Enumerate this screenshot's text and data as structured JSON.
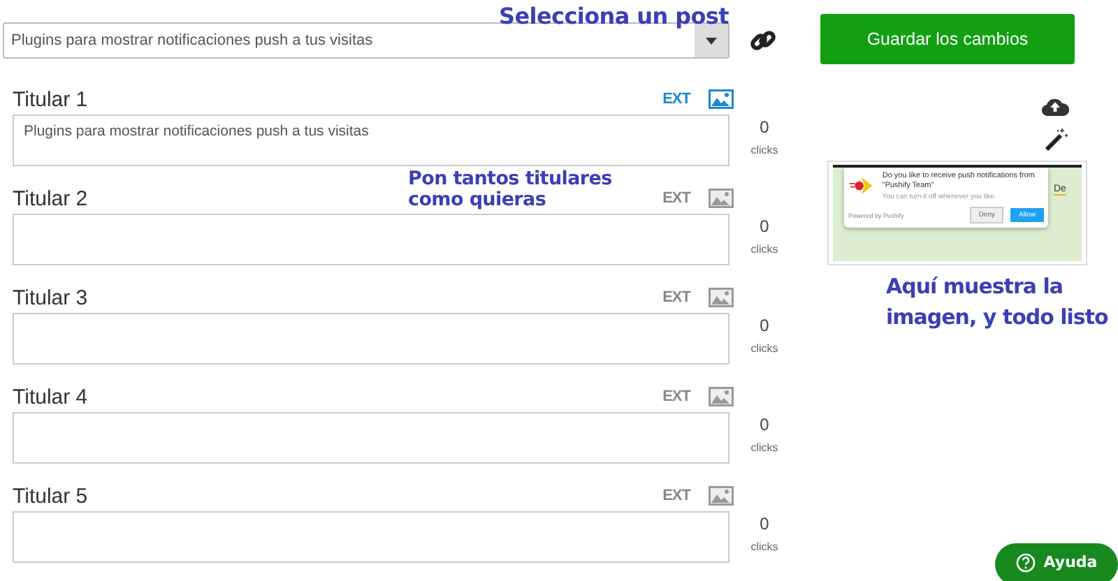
{
  "post_select": {
    "value": "Plugins para mostrar notificaciones push a tus visitas"
  },
  "save_button": "Guardar los cambios",
  "headlines": [
    {
      "label": "Titular 1",
      "ext": "EXT",
      "ext_active": true,
      "image_active": true,
      "value": "Plugins para mostrar notificaciones push a tus visitas",
      "clicks": "0",
      "clicks_label": "clicks"
    },
    {
      "label": "Titular 2",
      "ext": "EXT",
      "ext_active": false,
      "image_active": false,
      "clicks": "0",
      "clicks_label": "clicks"
    },
    {
      "label": "Titular 3",
      "ext": "EXT",
      "ext_active": false,
      "image_active": false,
      "clicks": "0",
      "clicks_label": "clicks"
    },
    {
      "label": "Titular 4",
      "ext": "EXT",
      "ext_active": false,
      "image_active": false,
      "clicks": "0",
      "clicks_label": "clicks"
    },
    {
      "label": "Titular 5",
      "ext": "EXT",
      "ext_active": false,
      "image_active": false,
      "clicks": "0",
      "clicks_label": "clicks"
    }
  ],
  "preview": {
    "message": "Do you like to receive push notifications from \"Pushify Team\"",
    "subtext": "You can turn it off whenever you like.",
    "powered": "Powered by Pushify",
    "deny": "Deny",
    "allow": "Allow",
    "side_text": "De"
  },
  "annotations": [
    {
      "kind": "select",
      "lines": [
        "Selecciona un post"
      ]
    },
    {
      "kind": "headlines",
      "lines": [
        "Pon tantos titulares",
        "como quieras"
      ]
    },
    {
      "kind": "image",
      "lines": [
        "Aquí muestra la",
        "imagen, y todo listo"
      ]
    }
  ],
  "help_button": "Ayuda"
}
